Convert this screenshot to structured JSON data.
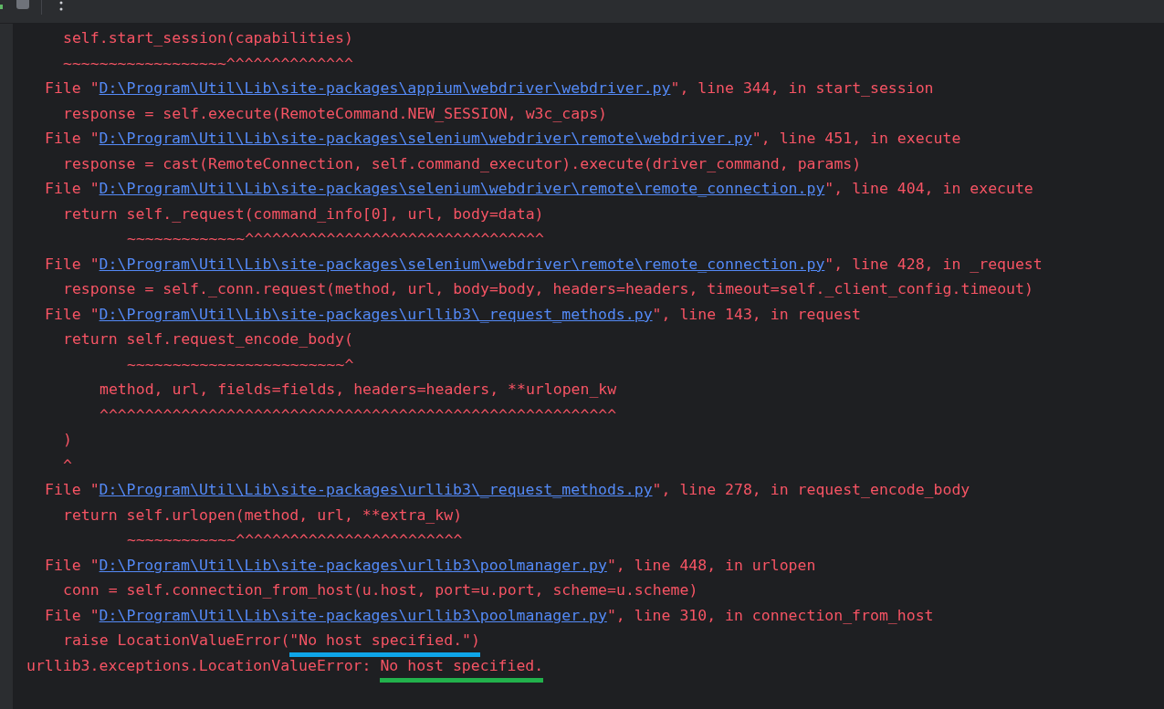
{
  "console": {
    "lines": [
      {
        "kind": "text",
        "text": "    self.start_session(capabilities)"
      },
      {
        "kind": "text",
        "text": "    ~~~~~~~~~~~~~~~~~~^^^^^^^^^^^^^^"
      },
      {
        "kind": "file",
        "prefix": "  File \"",
        "path": "D:\\Program\\Util\\Lib\\site-packages\\appium\\webdriver\\webdriver.py",
        "suffix": "\", line 344, in start_session"
      },
      {
        "kind": "text",
        "text": "    response = self.execute(RemoteCommand.NEW_SESSION, w3c_caps)"
      },
      {
        "kind": "file",
        "prefix": "  File \"",
        "path": "D:\\Program\\Util\\Lib\\site-packages\\selenium\\webdriver\\remote\\webdriver.py",
        "suffix": "\", line 451, in execute"
      },
      {
        "kind": "text",
        "text": "    response = cast(RemoteConnection, self.command_executor).execute(driver_command, params)"
      },
      {
        "kind": "file",
        "prefix": "  File \"",
        "path": "D:\\Program\\Util\\Lib\\site-packages\\selenium\\webdriver\\remote\\remote_connection.py",
        "suffix": "\", line 404, in execute"
      },
      {
        "kind": "text",
        "text": "    return self._request(command_info[0], url, body=data)"
      },
      {
        "kind": "text",
        "text": "           ~~~~~~~~~~~~~^^^^^^^^^^^^^^^^^^^^^^^^^^^^^^^^^"
      },
      {
        "kind": "file",
        "prefix": "  File \"",
        "path": "D:\\Program\\Util\\Lib\\site-packages\\selenium\\webdriver\\remote\\remote_connection.py",
        "suffix": "\", line 428, in _request"
      },
      {
        "kind": "text",
        "text": "    response = self._conn.request(method, url, body=body, headers=headers, timeout=self._client_config.timeout)"
      },
      {
        "kind": "file",
        "prefix": "  File \"",
        "path": "D:\\Program\\Util\\Lib\\site-packages\\urllib3\\_request_methods.py",
        "suffix": "\", line 143, in request"
      },
      {
        "kind": "text",
        "text": "    return self.request_encode_body("
      },
      {
        "kind": "text",
        "text": "           ~~~~~~~~~~~~~~~~~~~~~~~~^"
      },
      {
        "kind": "text",
        "text": "        method, url, fields=fields, headers=headers, **urlopen_kw"
      },
      {
        "kind": "text",
        "text": "        ^^^^^^^^^^^^^^^^^^^^^^^^^^^^^^^^^^^^^^^^^^^^^^^^^^^^^^^^^"
      },
      {
        "kind": "text",
        "text": "    )"
      },
      {
        "kind": "text",
        "text": "    ^"
      },
      {
        "kind": "file",
        "prefix": "  File \"",
        "path": "D:\\Program\\Util\\Lib\\site-packages\\urllib3\\_request_methods.py",
        "suffix": "\", line 278, in request_encode_body"
      },
      {
        "kind": "text",
        "text": "    return self.urlopen(method, url, **extra_kw)"
      },
      {
        "kind": "text",
        "text": "           ~~~~~~~~~~~~^^^^^^^^^^^^^^^^^^^^^^^^^"
      },
      {
        "kind": "file",
        "prefix": "  File \"",
        "path": "D:\\Program\\Util\\Lib\\site-packages\\urllib3\\poolmanager.py",
        "suffix": "\", line 448, in urlopen"
      },
      {
        "kind": "text",
        "text": "    conn = self.connection_from_host(u.host, port=u.port, scheme=u.scheme)"
      },
      {
        "kind": "file",
        "prefix": "  File \"",
        "path": "D:\\Program\\Util\\Lib\\site-packages\\urllib3\\poolmanager.py",
        "suffix": "\", line 310, in connection_from_host"
      },
      {
        "kind": "marked",
        "text": "    raise LocationValueError(",
        "marked": "\"No host specified.\")",
        "color": "#0ea5e9"
      },
      {
        "kind": "marked",
        "text": "urllib3.exceptions.LocationValueError: ",
        "marked": "No host specified.",
        "color": "#22b14c"
      }
    ]
  }
}
